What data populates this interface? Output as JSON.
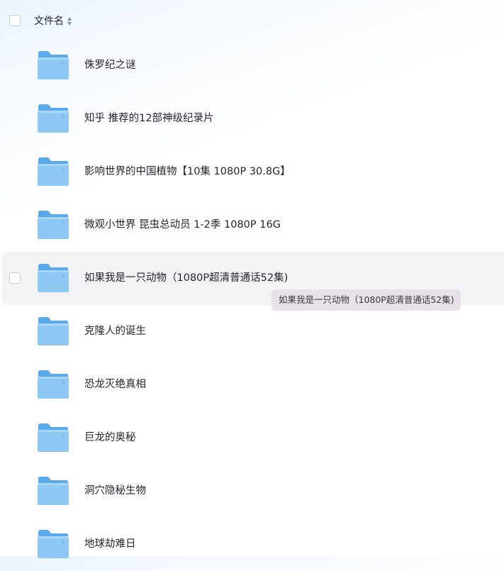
{
  "header": {
    "column_label": "文件名"
  },
  "files": [
    {
      "name": "侏罗纪之谜",
      "type": "folder"
    },
    {
      "name": "知乎 推荐的12部神级纪录片",
      "type": "folder"
    },
    {
      "name": "影响世界的中国植物【10集 1080P 30.8G】",
      "type": "folder"
    },
    {
      "name": "微观小世界 昆虫总动员 1-2季 1080P 16G",
      "type": "folder"
    },
    {
      "name": "如果我是一只动物（1080P超清普通话52集)",
      "type": "folder",
      "hovered": true
    },
    {
      "name": "克隆人的诞生",
      "type": "folder"
    },
    {
      "name": "恐龙灭绝真相",
      "type": "folder"
    },
    {
      "name": "巨龙的奥秘",
      "type": "folder"
    },
    {
      "name": "洞穴隐秘生物",
      "type": "folder"
    },
    {
      "name": "地球劫难日",
      "type": "folder"
    }
  ],
  "tooltip": {
    "text": "如果我是一只动物（1080P超清普通话52集)"
  },
  "colors": {
    "folder_body": "#8ec8f4",
    "folder_back": "#5aa9ea",
    "hover_row": "#f3f3f5",
    "tooltip_bg": "#e6e2e7"
  },
  "icons": {
    "folder": "folder-icon",
    "sort": "sort-icon"
  }
}
